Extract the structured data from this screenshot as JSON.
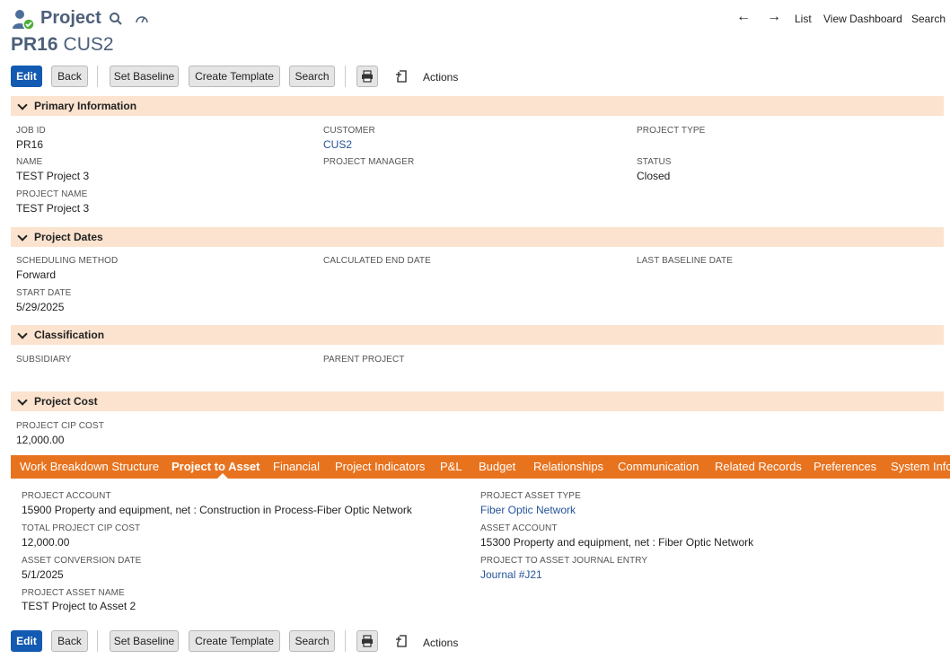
{
  "header": {
    "record_type": "Project",
    "record_id": "PR16",
    "record_sub": "CUS2",
    "nav": {
      "list": "List",
      "view_dashboard": "View Dashboard",
      "search": "Search"
    }
  },
  "toolbar": {
    "edit": "Edit",
    "back": "Back",
    "set_baseline": "Set Baseline",
    "create_template": "Create Template",
    "search": "Search",
    "actions": "Actions"
  },
  "sections": {
    "primary": {
      "title": "Primary Information",
      "job_id_label": "JOB ID",
      "job_id": "PR16",
      "customer_label": "CUSTOMER",
      "customer": "CUS2",
      "project_type_label": "PROJECT TYPE",
      "name_label": "NAME",
      "name": "TEST Project 3",
      "project_manager_label": "PROJECT MANAGER",
      "status_label": "STATUS",
      "status": "Closed",
      "project_name_label": "PROJECT NAME",
      "project_name": "TEST Project 3"
    },
    "dates": {
      "title": "Project Dates",
      "scheduling_method_label": "SCHEDULING METHOD",
      "scheduling_method": "Forward",
      "calc_end_label": "CALCULATED END DATE",
      "last_baseline_label": "LAST BASELINE DATE",
      "start_date_label": "START DATE",
      "start_date": "5/29/2025"
    },
    "classification": {
      "title": "Classification",
      "subsidiary_label": "SUBSIDIARY",
      "parent_project_label": "PARENT PROJECT"
    },
    "cost": {
      "title": "Project Cost",
      "cip_cost_label": "PROJECT CIP COST",
      "cip_cost": "12,000.00"
    }
  },
  "tabs": [
    {
      "label": "Work Breakdown Structure"
    },
    {
      "label": "Project to Asset"
    },
    {
      "label": "Financial"
    },
    {
      "label": "Project Indicators"
    },
    {
      "label": "P&L"
    },
    {
      "label": "Budget"
    },
    {
      "label": "Relationships"
    },
    {
      "label": "Communication"
    },
    {
      "label": "Related Records"
    },
    {
      "label": "Preferences"
    },
    {
      "label": "System Infor"
    }
  ],
  "asset": {
    "project_account_label": "PROJECT ACCOUNT",
    "project_account": "15900 Property and equipment, net : Construction in Process-Fiber Optic Network",
    "total_cip_label": "TOTAL PROJECT CIP COST",
    "total_cip": "12,000.00",
    "conversion_date_label": "ASSET CONVERSION DATE",
    "conversion_date": "5/1/2025",
    "asset_name_label": "PROJECT ASSET NAME",
    "asset_name": "TEST Project to Asset 2",
    "asset_type_label": "PROJECT ASSET TYPE",
    "asset_type": "Fiber Optic Network",
    "asset_account_label": "ASSET ACCOUNT",
    "asset_account": "15300 Property and equipment, net : Fiber Optic Network",
    "journal_entry_label": "PROJECT TO ASSET JOURNAL ENTRY",
    "journal_entry": "Journal #J21"
  },
  "colors": {
    "brand": "#4d5f79",
    "primary_button": "#125ab2",
    "section_bg": "#fbe3cf",
    "tabbar": "#e8731f",
    "link": "#255599"
  }
}
